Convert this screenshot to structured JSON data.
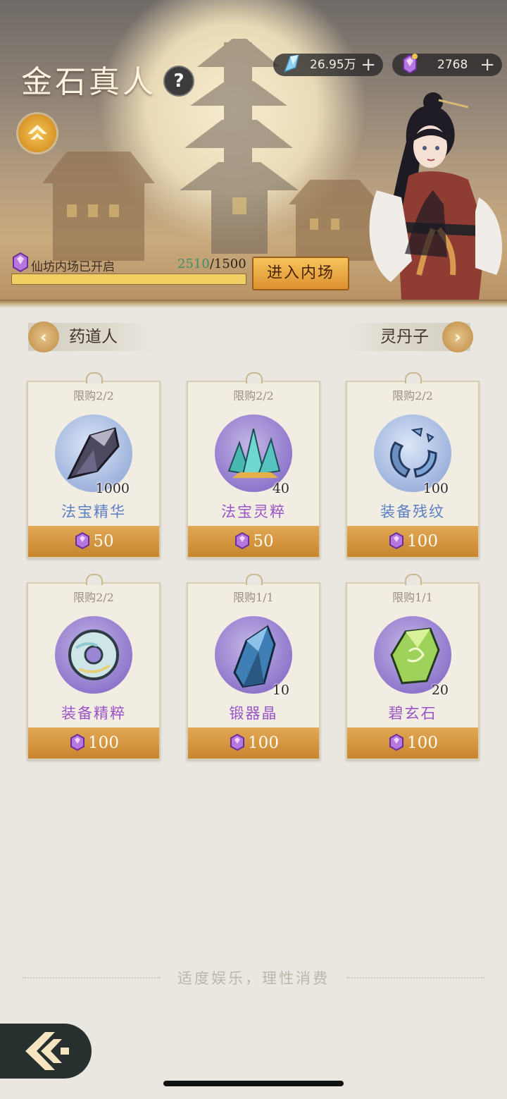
{
  "header": {
    "title": "金石真人",
    "help_symbol": "?",
    "resources": [
      {
        "icon": "spirit-stone-icon",
        "value": "26.95万",
        "plus": "+"
      },
      {
        "icon": "purple-gem-icon",
        "value": "2768",
        "plus": "+"
      }
    ],
    "progress": {
      "label": "仙坊内场已开启",
      "current": "2510",
      "separator": "/",
      "total": "1500",
      "fill_fraction": 1.0
    },
    "enter_button": "进入内场"
  },
  "merchants": {
    "prev": "药道人",
    "next": "灵丹子"
  },
  "items": [
    {
      "limit": "限购2/2",
      "qty": "1000",
      "name": "法宝精华",
      "price": "50",
      "name_color": "#5b7fc2",
      "icon": "dark-crystal-icon",
      "disc": "blue"
    },
    {
      "limit": "限购2/2",
      "qty": "40",
      "name": "法宝灵粹",
      "price": "50",
      "name_color": "#9a53c5",
      "icon": "teal-crystal-icon",
      "disc": "purple"
    },
    {
      "limit": "限购2/2",
      "qty": "100",
      "name": "装备残纹",
      "price": "100",
      "name_color": "#5b7fc2",
      "icon": "broken-ring-icon",
      "disc": "blue"
    },
    {
      "limit": "限购2/2",
      "qty": "",
      "name": "装备精粹",
      "price": "100",
      "name_color": "#9a53c5",
      "icon": "jade-ring-icon",
      "disc": "purple"
    },
    {
      "limit": "限购1/1",
      "qty": "10",
      "name": "锻器晶",
      "price": "100",
      "name_color": "#9a53c5",
      "icon": "blue-shard-icon",
      "disc": "purple"
    },
    {
      "limit": "限购1/1",
      "qty": "20",
      "name": "碧玄石",
      "price": "100",
      "name_color": "#9a53c5",
      "icon": "green-stone-icon",
      "disc": "purple"
    }
  ],
  "footer": {
    "note": "适度娱乐，理性消费"
  }
}
